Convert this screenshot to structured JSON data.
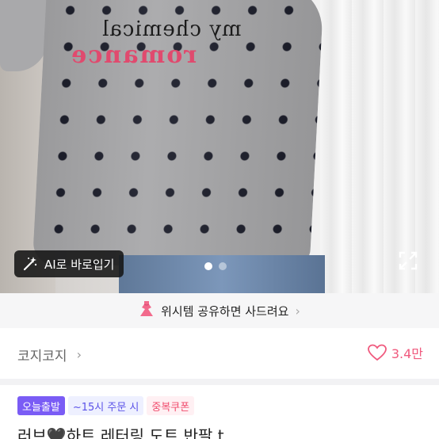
{
  "photo": {
    "print_line1": "my chemical",
    "print_line2": "romance",
    "ai_button_label": "AI로 바로입기",
    "ai_icon": "magic-wand-icon",
    "expand_icon": "expand-icon",
    "carousel": {
      "pages": 2,
      "current": 1
    }
  },
  "wishlist_banner": {
    "icon": "dress-icon",
    "text": "위시템 공유하면 사드려요",
    "chevron": "›"
  },
  "shop": {
    "name": "코지코지",
    "chevron": "›",
    "like_icon": "heart-icon",
    "like_count": "3.4만"
  },
  "badges": {
    "fast_shipping": "오늘출발",
    "order_time": "~15시 주문 시",
    "coupon": "중복쿠폰"
  },
  "product": {
    "title": "러브🖤하트 레터링 도트 반팔 t"
  },
  "colors": {
    "accent_pink": "#f05a7e",
    "badge_purple": "#7a5cf5",
    "coupon_red": "#f04d6e"
  }
}
